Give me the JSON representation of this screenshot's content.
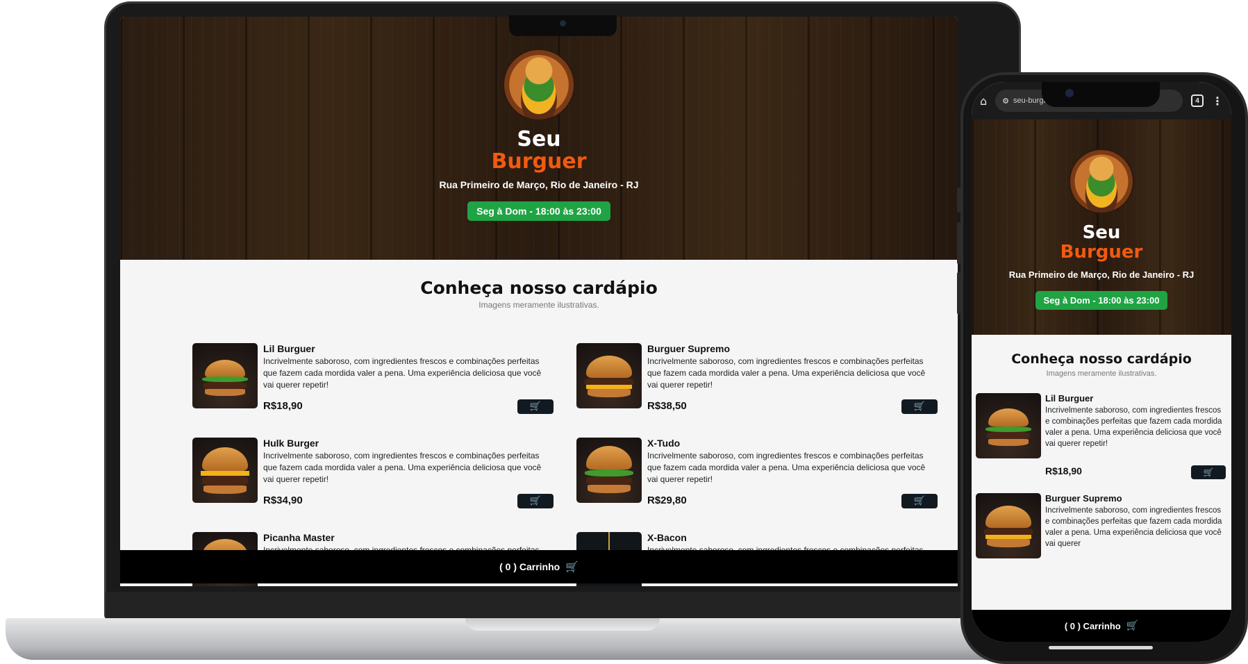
{
  "app": {
    "brand_line1": "Seu",
    "brand_line2": "Burguer",
    "address": "Rua Primeiro de Março, Rio de Janeiro - RJ",
    "hours": "Seg à Dom - 18:00 às 23:00",
    "accent_color": "#f25a0f",
    "hours_color": "#20a344"
  },
  "menu": {
    "title": "Conheça nosso cardápio",
    "subtitle": "Imagens meramente ilustrativas.",
    "items": [
      {
        "name": "Lil Burguer",
        "description": "Incrivelmente saboroso, com ingredientes frescos e combinações perfeitas que fazem cada mordida valer a pena. Uma experiência deliciosa que você vai querer repetir!",
        "price": "R$18,90"
      },
      {
        "name": "Burguer Supremo",
        "description": "Incrivelmente saboroso, com ingredientes frescos e combinações perfeitas que fazem cada mordida valer a pena. Uma experiência deliciosa que você vai querer repetir!",
        "price": "R$38,50"
      },
      {
        "name": "Hulk Burger",
        "description": "Incrivelmente saboroso, com ingredientes frescos e combinações perfeitas que fazem cada mordida valer a pena. Uma experiência deliciosa que você vai querer repetir!",
        "price": "R$34,90"
      },
      {
        "name": "X-Tudo",
        "description": "Incrivelmente saboroso, com ingredientes frescos e combinações perfeitas que fazem cada mordida valer a pena. Uma experiência deliciosa que você vai querer repetir!",
        "price": "R$29,80"
      },
      {
        "name": "Picanha Master",
        "description": "Incrivelmente saboroso, com ingredientes frescos e combinações perfeitas que fazem cada mordida valer a pena. Uma experiência",
        "price": ""
      },
      {
        "name": "X-Bacon",
        "description": "Incrivelmente saboroso, com ingredientes frescos e combinações perfeitas que fazem cada mordida valer a pena. Uma experiência",
        "price": ""
      }
    ],
    "phone_items": [
      {
        "name": "Lil Burguer",
        "description": "Incrivelmente saboroso, com ingredientes frescos e combinações perfeitas que fazem cada mordida valer a pena. Uma experiência deliciosa que você vai querer repetir!",
        "price": "R$18,90"
      },
      {
        "name": "Burguer Supremo",
        "description": "Incrivelmente saboroso, com ingredientes frescos e combinações perfeitas que fazem cada mordida valer a pena. Uma experiência deliciosa que você vai querer",
        "price": ""
      }
    ]
  },
  "cart": {
    "count_display": "( 0 ) Carrinho",
    "icon": "cart-icon"
  },
  "browser": {
    "url": "seu-burgu",
    "tab_count": "4",
    "icons": [
      "home-icon",
      "site-info-icon",
      "tabs-icon",
      "more-icon"
    ]
  }
}
